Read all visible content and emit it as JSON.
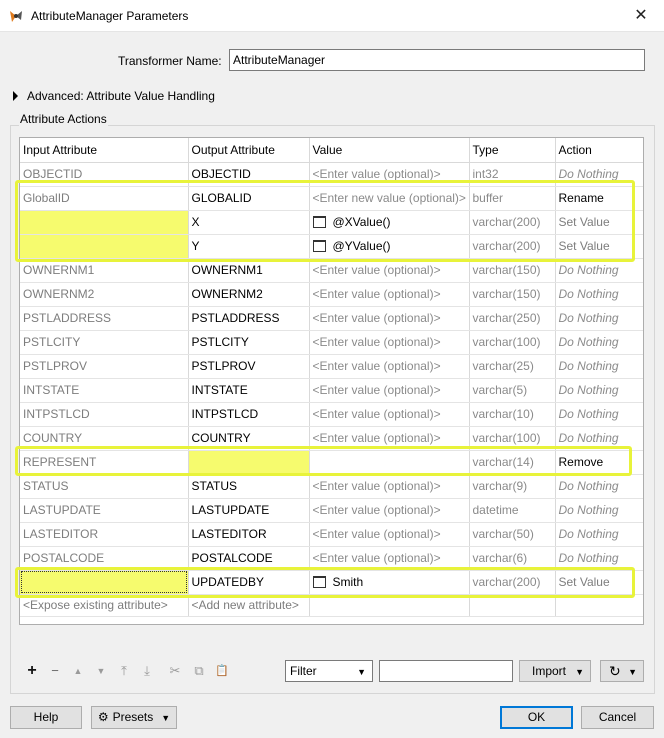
{
  "window": {
    "title": "AttributeManager Parameters",
    "close_glyph": "✕"
  },
  "transformer": {
    "label": "Transformer Name:",
    "value": "AttributeManager"
  },
  "advanced": {
    "label": "Advanced: Attribute Value Handling"
  },
  "attribute_actions": {
    "label": "Attribute Actions"
  },
  "table": {
    "headers": [
      "Input Attribute",
      "Output Attribute",
      "Value",
      "Type",
      "Action"
    ],
    "rows": [
      {
        "input": "OBJECTID",
        "output": "OBJECTID",
        "value": "<Enter value (optional)>",
        "type": "int32",
        "action": "Do Nothing"
      },
      {
        "input": "GlobalID",
        "output": "GLOBALID",
        "value": "<Enter new value (optional)>",
        "type": "buffer",
        "action": "Rename"
      },
      {
        "input": "",
        "output": "X",
        "value": "@XValue()",
        "type": "varchar(200)",
        "action": "Set Value"
      },
      {
        "input": "",
        "output": "Y",
        "value": "@YValue()",
        "type": "varchar(200)",
        "action": "Set Value"
      },
      {
        "input": "OWNERNM1",
        "output": "OWNERNM1",
        "value": "<Enter value (optional)>",
        "type": "varchar(150)",
        "action": "Do Nothing"
      },
      {
        "input": "OWNERNM2",
        "output": "OWNERNM2",
        "value": "<Enter value (optional)>",
        "type": "varchar(150)",
        "action": "Do Nothing"
      },
      {
        "input": "PSTLADDRESS",
        "output": "PSTLADDRESS",
        "value": "<Enter value (optional)>",
        "type": "varchar(250)",
        "action": "Do Nothing"
      },
      {
        "input": "PSTLCITY",
        "output": "PSTLCITY",
        "value": "<Enter value (optional)>",
        "type": "varchar(100)",
        "action": "Do Nothing"
      },
      {
        "input": "PSTLPROV",
        "output": "PSTLPROV",
        "value": "<Enter value (optional)>",
        "type": "varchar(25)",
        "action": "Do Nothing"
      },
      {
        "input": "INTSTATE",
        "output": "INTSTATE",
        "value": "<Enter value (optional)>",
        "type": "varchar(5)",
        "action": "Do Nothing"
      },
      {
        "input": "INTPSTLCD",
        "output": "INTPSTLCD",
        "value": "<Enter value (optional)>",
        "type": "varchar(10)",
        "action": "Do Nothing"
      },
      {
        "input": "COUNTRY",
        "output": "COUNTRY",
        "value": "<Enter value (optional)>",
        "type": "varchar(100)",
        "action": "Do Nothing"
      },
      {
        "input": "REPRESENT",
        "output": "",
        "value": "",
        "type": "varchar(14)",
        "action": "Remove"
      },
      {
        "input": "STATUS",
        "output": "STATUS",
        "value": "<Enter value (optional)>",
        "type": "varchar(9)",
        "action": "Do Nothing"
      },
      {
        "input": "LASTUPDATE",
        "output": "LASTUPDATE",
        "value": "<Enter value (optional)>",
        "type": "datetime",
        "action": "Do Nothing"
      },
      {
        "input": "LASTEDITOR",
        "output": "LASTEDITOR",
        "value": "<Enter value (optional)>",
        "type": "varchar(50)",
        "action": "Do Nothing"
      },
      {
        "input": "POSTALCODE",
        "output": "POSTALCODE",
        "value": "<Enter value (optional)>",
        "type": "varchar(6)",
        "action": "Do Nothing"
      },
      {
        "input": "",
        "output": "UPDATEDBY",
        "value": "Smith",
        "type": "varchar(200)",
        "action": "Set Value"
      }
    ],
    "footer": {
      "input": "<Expose existing attribute>",
      "output": "<Add new attribute>"
    }
  },
  "toolbar": {
    "add": "+",
    "remove": "−",
    "move_up": "▲",
    "move_down": "▼",
    "move_top": "⤒",
    "move_bottom": "⤓",
    "cut": "✂",
    "copy": "⧉",
    "paste": "📋"
  },
  "filter": {
    "value": "Filter",
    "search_value": ""
  },
  "import_label": "Import",
  "refresh_glyph": "↻",
  "buttons": {
    "help": "Help",
    "presets": "Presets",
    "ok": "OK",
    "cancel": "Cancel"
  },
  "colors": {
    "highlight": "#e8f33a",
    "cell_highlight": "#f6fb6e",
    "ok_border": "#0078d7"
  }
}
